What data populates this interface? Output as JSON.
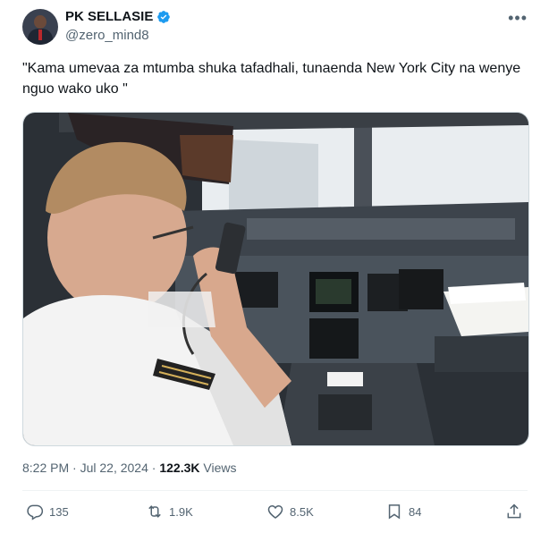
{
  "author": {
    "name": "PK SELLASIE",
    "handle": "@zero_mind8",
    "verified": true
  },
  "post": {
    "text": "\"Kama umevaa za mtumba shuka tafadhali, tunaenda New York City na wenye nguo wako uko \"",
    "time": "8:22 PM",
    "separator": "·",
    "date": "Jul 22, 2024",
    "separator2": "·",
    "views_count": "122.3K",
    "views_label": "Views"
  },
  "actions": {
    "replies": "135",
    "reposts": "1.9K",
    "likes": "8.5K",
    "bookmarks": "84"
  },
  "colors": {
    "verified": "#1d9bf0",
    "secondary_text": "#536471"
  },
  "icons": [
    "more-icon",
    "verified-icon",
    "reply-icon",
    "repost-icon",
    "like-icon",
    "bookmark-icon",
    "share-icon"
  ]
}
